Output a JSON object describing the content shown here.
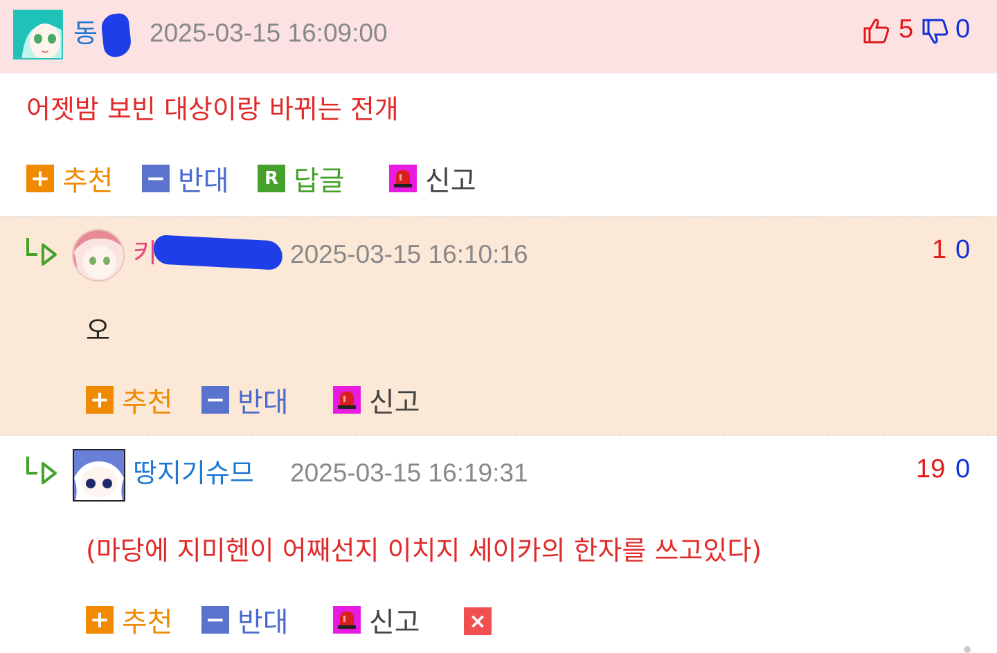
{
  "comments": [
    {
      "nick": "동",
      "timestamp": "2025-03-15 16:09:00",
      "up": "5",
      "down": "0",
      "body": "어젯밤 보빈 대상이랑 바뀌는 전개",
      "actions": {
        "up": "추천",
        "down": "반대",
        "reply": "답글",
        "report": "신고"
      }
    },
    {
      "nick": "키",
      "timestamp": "2025-03-15 16:10:16",
      "up": "1",
      "down": "0",
      "body": "오",
      "actions": {
        "up": "추천",
        "down": "반대",
        "report": "신고"
      }
    },
    {
      "nick": "땅지기슈므",
      "timestamp": "2025-03-15 16:19:31",
      "up": "19",
      "down": "0",
      "body": "(마당에 지미헨이 어째선지 이치지 세이카의 한자를 쓰고있다)",
      "actions": {
        "up": "추천",
        "down": "반대",
        "report": "신고"
      }
    }
  ],
  "icons": {
    "thumb_up": "thumb-up-icon",
    "thumb_down": "thumb-down-icon",
    "reply_arrow": "reply-arrow-icon",
    "plus": "plus-icon",
    "minus": "minus-icon",
    "reply_box": "R",
    "siren": "siren-icon",
    "delete": "×"
  },
  "colors": {
    "vote_up": "#e01a1a",
    "vote_down": "#1030d8",
    "header_bg": "#fde2e4",
    "reply_bg": "#fce8d6"
  }
}
